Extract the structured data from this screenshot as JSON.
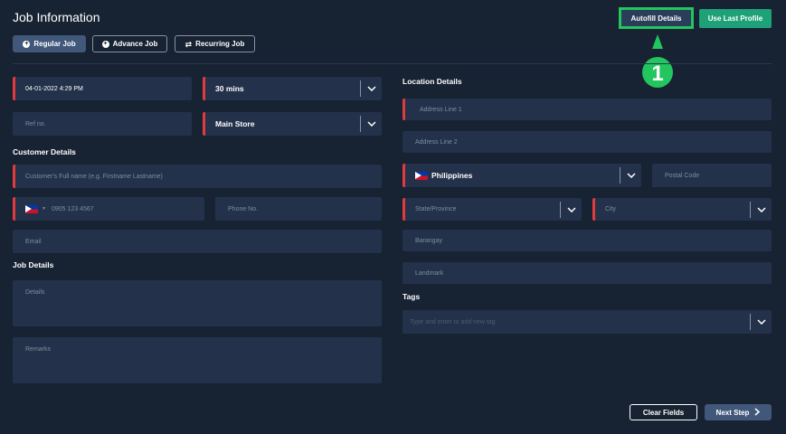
{
  "page": {
    "title": "Job Information"
  },
  "tabs": [
    {
      "label": "Regular Job",
      "icon": "plus-circle-icon"
    },
    {
      "label": "Advance Job",
      "icon": "plus-circle-icon"
    },
    {
      "label": "Recurring Job",
      "icon": "refresh-icon"
    }
  ],
  "actions": {
    "autofill_label": "Autofill Details",
    "last_profile_label": "Use Last Profile",
    "step_marker": "1",
    "clear_label": "Clear Fields",
    "next_label": "Next Step"
  },
  "job_info": {
    "datetime_value": "04-01-2022 4:29 PM",
    "duration_value": "30 mins",
    "ref_placeholder": "Ref no.",
    "store_value": "Main Store"
  },
  "customer": {
    "heading": "Customer Details",
    "fullname_placeholder": "Customer's Full name (e.g. Firstname Lastname)",
    "mobile_placeholder": "0905 123 4567",
    "phone_placeholder": "Phone No.",
    "email_placeholder": "Email"
  },
  "job_details": {
    "heading": "Job Details",
    "details_placeholder": "Details",
    "remarks_placeholder": "Remarks"
  },
  "location": {
    "heading": "Location Details",
    "address1_placeholder": "Address Line 1",
    "address2_placeholder": "Address Line 2",
    "country_value": "Philippines",
    "postal_placeholder": "Postal Code",
    "state_placeholder": "State/Province",
    "city_placeholder": "City",
    "barangay_placeholder": "Barangay",
    "landmark_placeholder": "Landmark"
  },
  "tags": {
    "heading": "Tags",
    "input_placeholder": "Type and enter to add new tag"
  },
  "colors": {
    "background": "#172232",
    "field": "#23324a",
    "required": "#e23b3b",
    "highlight": "#22c55e",
    "accent_green": "#1fa178",
    "button": "#41587a"
  }
}
